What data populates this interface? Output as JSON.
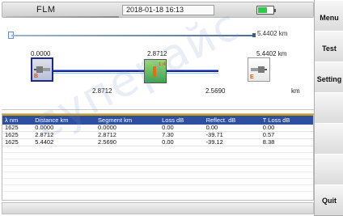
{
  "header": {
    "mode": "FLM",
    "datetime": "2018-01-18 16:13",
    "battery_level": 0.6,
    "battery_color": "#2cc84a"
  },
  "overview": {
    "total_distance": "5.4402 km",
    "events": [
      {
        "distance": "0.0000",
        "letter": "B",
        "tag": ""
      },
      {
        "distance": "2.8712",
        "letter": "",
        "tag": "1:4"
      },
      {
        "distance": "5.4402  km",
        "letter": "E",
        "tag": ""
      }
    ],
    "segments": [
      "2.8712",
      "2.5690"
    ],
    "unit": "km"
  },
  "table": {
    "columns": [
      "λ nm",
      "Distance km",
      "Segment km",
      "Loss dB",
      "Reflect. dB",
      "T Loss dB"
    ],
    "rows": [
      [
        "1625",
        "0.0000",
        "0.0000",
        "0.00",
        "0.00",
        "0.00"
      ],
      [
        "1625",
        "2.8712",
        "2.8712",
        "7.30",
        "-39.71",
        "0.57"
      ],
      [
        "1625",
        "5.4402",
        "2.5690",
        "0.00",
        "-39.12",
        "8.38"
      ]
    ]
  },
  "sidemenu": {
    "buttons": [
      "Menu",
      "Test",
      "Setting",
      "",
      "",
      "",
      "Quit"
    ]
  },
  "colors": {
    "table_header": "#2d4fa0",
    "fiber": "#1b2a8a",
    "event_pass": "#3ca44c",
    "accent": "#e05a12"
  },
  "watermark": "суперайс"
}
